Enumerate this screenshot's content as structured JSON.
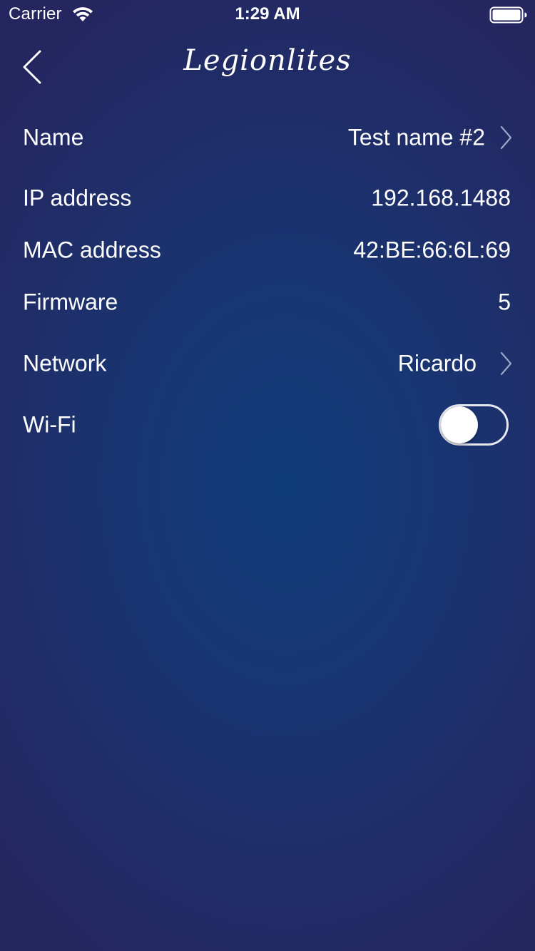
{
  "status_bar": {
    "carrier": "Carrier",
    "time": "1:29 AM",
    "wifi_icon": "wifi-icon",
    "battery_icon": "battery-full-icon"
  },
  "nav": {
    "back_icon": "chevron-left-icon",
    "title": "Legionlites"
  },
  "rows": {
    "name": {
      "label": "Name",
      "value": "Test name #2"
    },
    "ip": {
      "label": "IP address",
      "value": "192.168.1488"
    },
    "mac": {
      "label": "MAC address",
      "value": "42:BE:66:6L:69"
    },
    "firmware": {
      "label": "Firmware",
      "value": "5"
    },
    "network": {
      "label": "Network",
      "value": "Ricardo"
    },
    "wifi": {
      "label": "Wi-Fi",
      "enabled": false
    }
  },
  "colors": {
    "background_center": "#0e3c78",
    "background_edge": "#252660",
    "text": "#ffffff",
    "chevron": "#9aa6c8"
  }
}
